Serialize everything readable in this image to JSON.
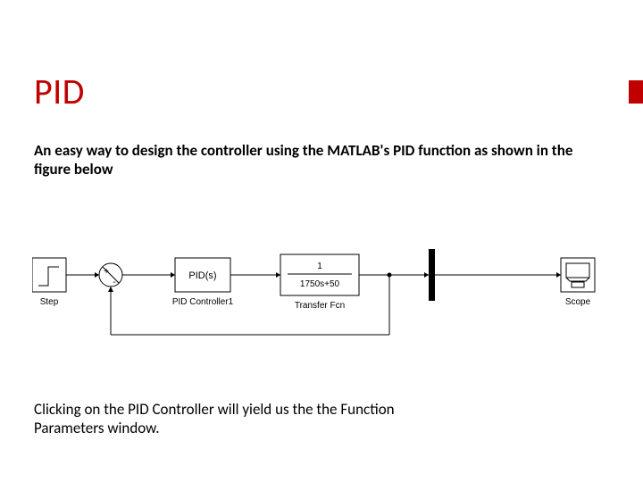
{
  "title": "PID",
  "intro": "An easy way to design the controller  using the MATLAB's PID function as shown in the figure below",
  "outro": "Clicking on the PID Controller will yield us the the Function Parameters window.",
  "diagram": {
    "step_label": "Step",
    "sum_plus": "+",
    "sum_minus": "-",
    "pid_block_text": "PID(s)",
    "pid_label": "PID Controller1",
    "tf_num": "1",
    "tf_den": "1750s+50",
    "tf_label": "Transfer Fcn",
    "scope_label": "Scope"
  }
}
